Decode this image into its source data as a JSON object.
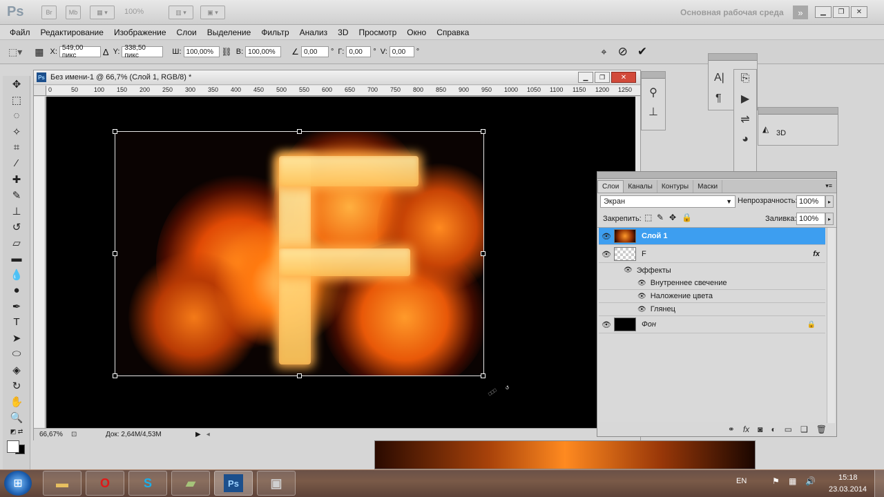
{
  "app": {
    "logo": "Ps",
    "zoom": "100%",
    "workspace": "Основная рабочая среда",
    "launcher_br": "Br",
    "launcher_mb": "Mb"
  },
  "menu": [
    "Файл",
    "Редактирование",
    "Изображение",
    "Слои",
    "Выделение",
    "Фильтр",
    "Анализ",
    "3D",
    "Просмотр",
    "Окно",
    "Справка"
  ],
  "options": {
    "x_label": "X:",
    "x_value": "549,00 пикс",
    "y_label": "Y:",
    "y_value": "338,50 пикс",
    "w_label": "Ш:",
    "w_value": "100,00%",
    "h_label": "В:",
    "h_value": "100,00%",
    "angle_value": "0,00",
    "angle_unit": "°",
    "hskew_label": "Г:",
    "hskew_value": "0,00",
    "vskew_label": "V:",
    "vskew_value": "0,00"
  },
  "document": {
    "title": "Без имени-1 @ 66,7% (Слой 1, RGB/8) *",
    "zoom": "66,67%",
    "doc_info": "Док: 2,64M/4,53M",
    "ruler": [
      "0",
      "50",
      "100",
      "150",
      "200",
      "250",
      "300",
      "350",
      "400",
      "450",
      "500",
      "550",
      "600",
      "650",
      "700",
      "750",
      "800",
      "850",
      "900",
      "950",
      "1000",
      "1050",
      "1100",
      "1150",
      "1200",
      "1250"
    ],
    "cursor_label": "□□□"
  },
  "panels": {
    "three_d_label": "3D"
  },
  "layers": {
    "tabs": [
      "Слои",
      "Каналы",
      "Контуры",
      "Маски"
    ],
    "blend_mode": "Экран",
    "opacity_label": "Непрозрачность:",
    "opacity_value": "100%",
    "lock_label": "Закрепить:",
    "fill_label": "Заливка:",
    "fill_value": "100%",
    "items": [
      {
        "name": "Слой 1",
        "selected": true
      },
      {
        "name": "F",
        "fx": "fx"
      },
      {
        "name": "Эффекты"
      },
      {
        "name": "Внутреннее свечение"
      },
      {
        "name": "Наложение цвета"
      },
      {
        "name": "Глянец"
      },
      {
        "name": "Фон"
      }
    ]
  },
  "taskbar": {
    "lang": "EN",
    "time": "15:18",
    "date": "23.03.2014",
    "ps_label": "Ps"
  },
  "colors": {
    "selection": "#3d9ef0",
    "canvas": "#000000",
    "flame": "#ff7a10"
  }
}
